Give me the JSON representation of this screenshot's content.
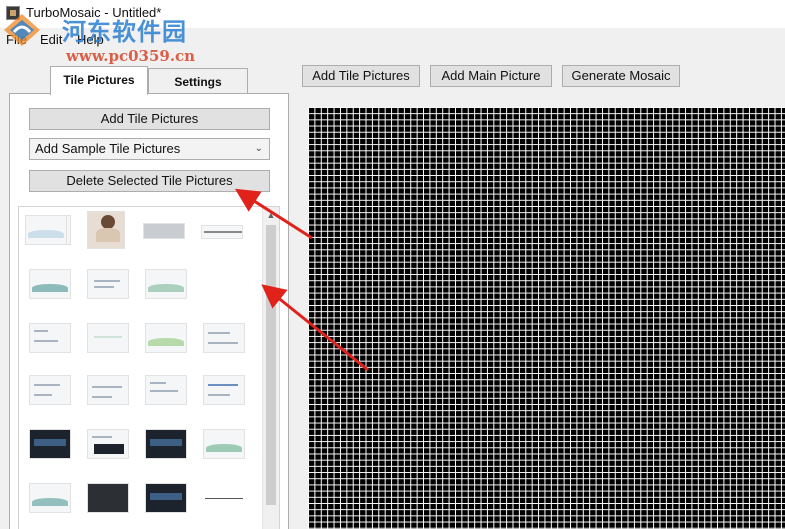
{
  "window": {
    "title": "TurboMosaic - Untitled*"
  },
  "menu": {
    "file": "File",
    "edit": "Edit",
    "help": "Help"
  },
  "watermark": {
    "cn": "河东软件园",
    "url": "www.pc0359.cn"
  },
  "tabs": [
    {
      "label": "Tile Pictures",
      "active": true
    },
    {
      "label": "Settings",
      "active": false
    }
  ],
  "left": {
    "add_tile": "Add Tile Pictures",
    "sample_combo": "Add Sample Tile Pictures",
    "delete_selected": "Delete Selected Tile Pictures"
  },
  "toolbar": {
    "add_tile": "Add Tile Pictures",
    "add_main": "Add Main Picture",
    "generate": "Generate Mosaic"
  },
  "thumbnails": [
    "screenshot",
    "photo",
    "grey-banner",
    "grey-banner",
    "screenshot-wave",
    "screenshot",
    "screenshot-wave",
    "screenshot-wave-selected",
    "screenshot",
    "screenshot",
    "screenshot-wave",
    "screenshot",
    "screenshot",
    "screenshot",
    "screenshot",
    "screenshot",
    "xforce-dark",
    "screenshot",
    "xforce-dark",
    "screenshot-wave",
    "screenshot-wave",
    "dark",
    "xforce-dark",
    "line"
  ],
  "colors": {
    "accent_arrow": "#e0221a",
    "selection": "#cde6f7",
    "mosaic_grid": "#ffffff",
    "mosaic_bg": "#000000"
  }
}
